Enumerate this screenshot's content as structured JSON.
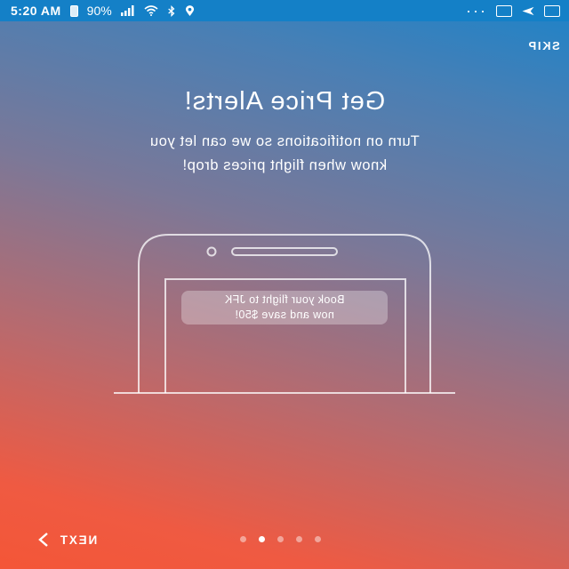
{
  "status_bar": {
    "time": "5:20 AM",
    "battery": "90%",
    "icons": [
      "battery-icon",
      "signal-icon",
      "wifi-icon",
      "bluetooth-icon",
      "location-icon",
      "more-icon",
      "notification-icon",
      "gallery-icon"
    ]
  },
  "onboarding": {
    "skip_label": "SKIP",
    "title": "Get Price Alerts!",
    "subtitle_line1": "Turn on notifications so we can let you",
    "subtitle_line2": "know when flight prices drop!",
    "notification_line1": "Book your flight to JFK",
    "notification_line2": "now and save $50!",
    "next_label": "NEXT"
  },
  "pager": {
    "total": 5,
    "active_index": 2
  },
  "colors": {
    "status_bar": "#1480c7",
    "gradient_top": "#1c83c9",
    "gradient_bottom": "#f45637"
  }
}
